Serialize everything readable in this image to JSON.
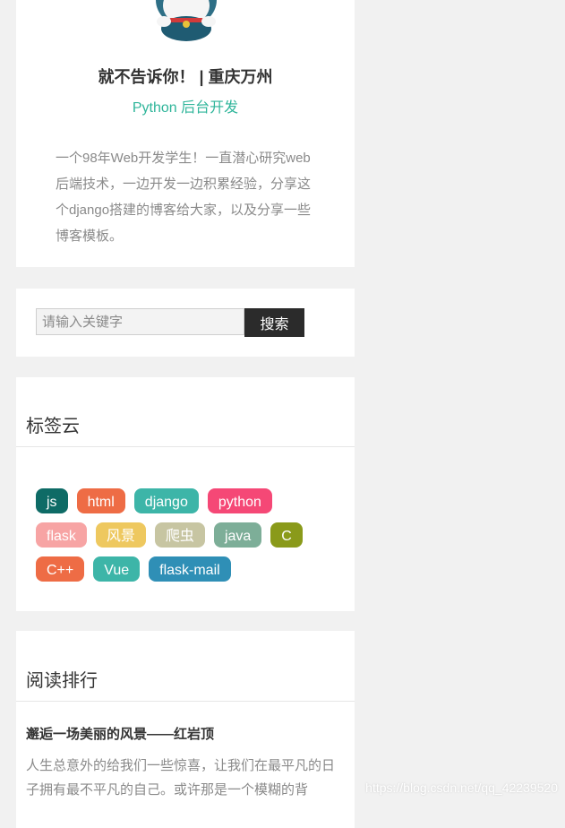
{
  "profile": {
    "name": "就不告诉你！ | 重庆万州",
    "role": "Python 后台开发",
    "bio": "一个98年Web开发学生！一直潜心研究web后端技术，一边开发一边积累经验，分享这个django搭建的博客给大家，以及分享一些博客模板。"
  },
  "search": {
    "placeholder": "请输入关键字",
    "button_label": "搜索"
  },
  "tag_cloud": {
    "title": "标签云",
    "rows": [
      [
        {
          "label": "js",
          "color": "#0e6b66"
        },
        {
          "label": "html",
          "color": "#ee6c45"
        },
        {
          "label": "django",
          "color": "#3db5a8"
        },
        {
          "label": "python",
          "color": "#f54876"
        }
      ],
      [
        {
          "label": "flask",
          "color": "#f7a4a4"
        },
        {
          "label": "风景",
          "color": "#eec85f"
        },
        {
          "label": "爬虫",
          "color": "#c7c5a2"
        },
        {
          "label": "java",
          "color": "#7dae98"
        },
        {
          "label": "C",
          "color": "#8a9a1a"
        }
      ],
      [
        {
          "label": "C++",
          "color": "#ee6c45"
        },
        {
          "label": "Vue",
          "color": "#3db5a8"
        },
        {
          "label": "flask-mail",
          "color": "#2f8fb6"
        }
      ]
    ]
  },
  "reading_rank": {
    "title": "阅读排行",
    "items": [
      {
        "title": "邂逅一场美丽的风景——红岩顶",
        "excerpt": "人生总意外的给我们一些惊喜，让我们在最平凡的日子拥有最不平凡的自己。或许那是一个模糊的背"
      }
    ]
  },
  "watermark": "https://blog.csdn.net/qq_42239520"
}
